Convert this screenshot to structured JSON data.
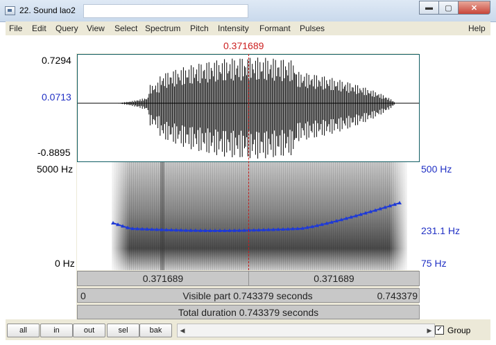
{
  "window": {
    "title": "22. Sound lao2",
    "buttons": {
      "minimize": "▬",
      "maximize": "▢",
      "close": "✕"
    }
  },
  "menu": [
    "File",
    "Edit",
    "Query",
    "View",
    "Select",
    "Spectrum",
    "Pitch",
    "Intensity",
    "Formant",
    "Pulses",
    "Help"
  ],
  "cursor_time": "0.371689",
  "waveform": {
    "max": "0.7294",
    "cursor_value": "0.0713",
    "min": "-0.8895"
  },
  "spectrogram": {
    "freq_top": "5000 Hz",
    "freq_bottom": "0 Hz",
    "pitch_top": "500 Hz",
    "pitch_cursor": "231.1 Hz",
    "pitch_bottom": "75 Hz"
  },
  "bars": {
    "left_segment": "0.371689",
    "right_segment": "0.371689",
    "visible_start": "0",
    "visible_label": "Visible part 0.743379 seconds",
    "visible_end": "0.743379",
    "total_label": "Total duration 0.743379 seconds"
  },
  "buttons": {
    "all": "all",
    "in": "in",
    "out": "out",
    "sel": "sel",
    "bak": "bak"
  },
  "group": {
    "label": "Group",
    "checked": true
  },
  "colors": {
    "pitch": "#1f3ad6",
    "cursor": "#cc1f1f"
  }
}
